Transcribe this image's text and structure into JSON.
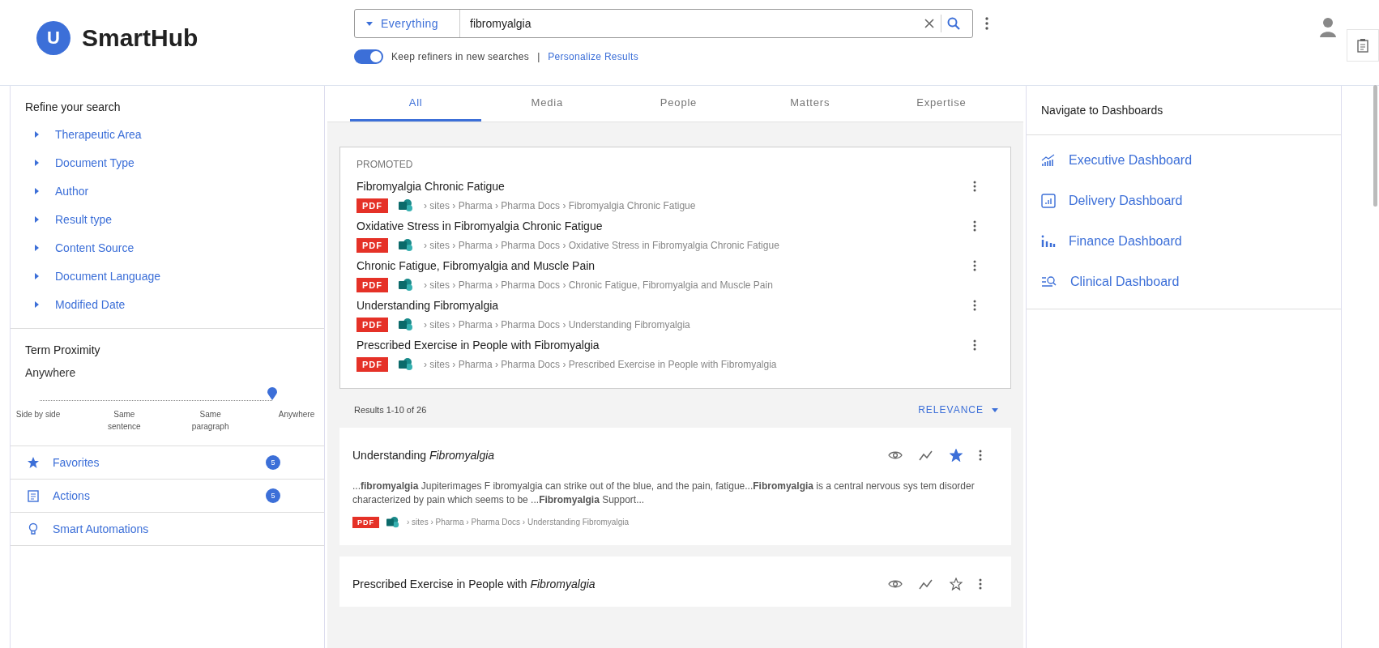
{
  "header": {
    "logo_letter": "U",
    "logo_text": "SmartHub",
    "search": {
      "scope": "Everything",
      "value": "fibromyalgia"
    },
    "keep_refiners": {
      "label": "Keep refiners in new searches",
      "on": true
    },
    "separator": "|",
    "personalize_link": "Personalize Results"
  },
  "refiners": {
    "title": "Refine your search",
    "items": [
      {
        "label": "Therapeutic Area",
        "expanded": false
      },
      {
        "label": "Document Type",
        "expanded": false
      },
      {
        "label": "Author",
        "expanded": false
      },
      {
        "label": "Result type",
        "expanded": false
      },
      {
        "label": "Content Source",
        "expanded": false
      },
      {
        "label": "Document Language",
        "expanded": false
      },
      {
        "label": "Modified Date",
        "expanded": false
      }
    ]
  },
  "term_proximity": {
    "title": "Term Proximity",
    "value": "Anywhere",
    "level": 1,
    "stops": [
      "Side by side",
      "Same sentence",
      "Same paragraph",
      "Anywhere"
    ]
  },
  "side_links": [
    {
      "kind": "star",
      "label": "Favorites",
      "badge": "5"
    },
    {
      "kind": "clipboard",
      "label": "Actions",
      "badge": "5"
    },
    {
      "kind": "bulb",
      "label": "Smart Automations"
    }
  ],
  "tabs": [
    {
      "label": "All",
      "selected": true
    },
    {
      "label": "Media",
      "selected": false
    },
    {
      "label": "People",
      "selected": false
    },
    {
      "label": "Matters",
      "selected": false
    },
    {
      "label": "Expertise",
      "selected": false
    }
  ],
  "promoted": {
    "heading": "PROMOTED",
    "items": [
      {
        "title": "Fibromyalgia Chronic Fatigue",
        "type": "PDF",
        "path": "› sites › Pharma › Pharma Docs › Fibromyalgia Chronic Fatigue"
      },
      {
        "title": "Oxidative Stress in Fibromyalgia Chronic Fatigue",
        "type": "PDF",
        "path": "› sites › Pharma › Pharma Docs › Oxidative Stress in Fibromyalgia Chronic Fatigue"
      },
      {
        "title": "Chronic Fatigue, Fibromyalgia and Muscle Pain",
        "type": "PDF",
        "path": "› sites › Pharma › Pharma Docs › Chronic Fatigue, Fibromyalgia and Muscle Pain"
      },
      {
        "title": "Understanding Fibromyalgia",
        "type": "PDF",
        "path": "› sites › Pharma › Pharma Docs › Understanding Fibromyalgia"
      },
      {
        "title": "Prescribed Exercise in People with Fibromyalgia",
        "type": "PDF",
        "path": "› sites › Pharma › Pharma Docs › Prescribed Exercise in People with Fibromyalgia"
      }
    ]
  },
  "results_count": "Results 1-10 of 26",
  "sort": "RELEVANCE",
  "results": [
    {
      "title": "Understanding *Fibromyalgia*",
      "favorite": true,
      "snippet": "...**fibromyalgia** Jupiterimages F ibromyalgia can strike out of the blue, and the pain, fatigue...**Fibromyalgia** is a central nervous sys tem disorder characterized by pain which seems to be ...**Fibromyalgia** Support...",
      "type": "PDF",
      "path": "› sites › Pharma › Pharma Docs › Understanding Fibromyalgia"
    },
    {
      "title": "Prescribed Exercise in People with *Fibromyalgia*",
      "favorite": false
    }
  ],
  "dashboards": {
    "title": "Navigate to Dashboards",
    "items": [
      {
        "kind": "trend",
        "label": "Executive Dashboard"
      },
      {
        "kind": "report",
        "label": "Delivery Dashboard"
      },
      {
        "kind": "bars",
        "label": "Finance Dashboard"
      },
      {
        "kind": "search",
        "label": "Clinical Dashboard"
      }
    ]
  }
}
